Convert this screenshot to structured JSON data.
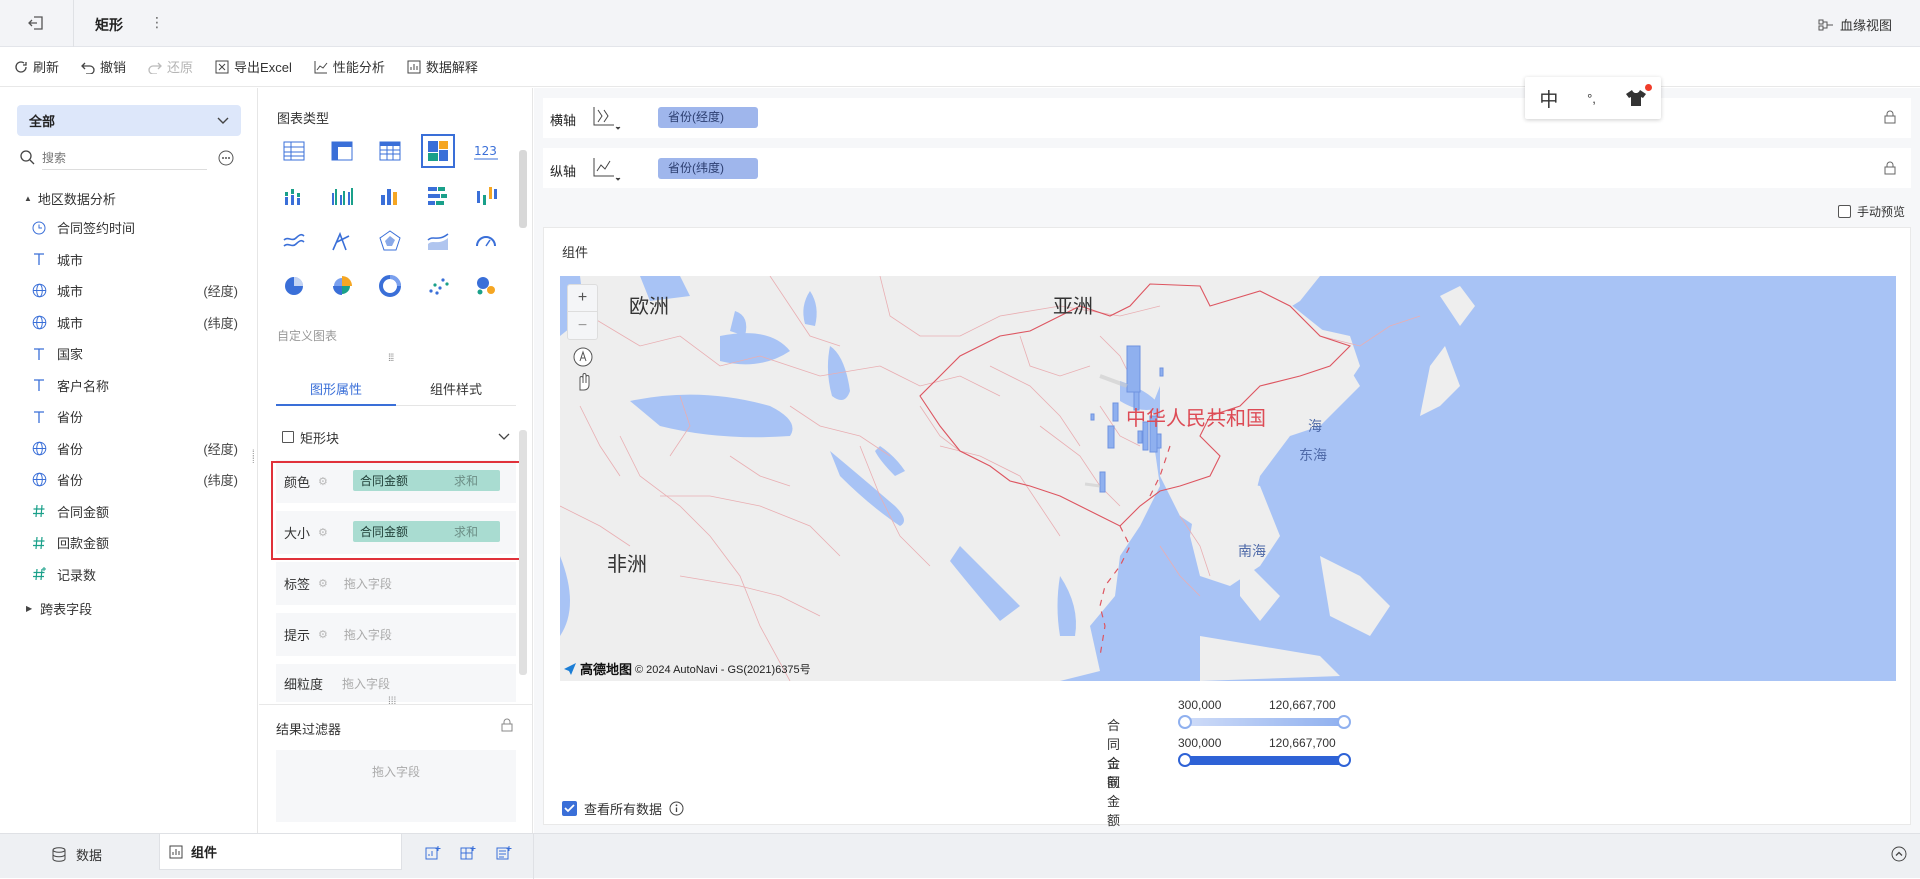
{
  "topbar": {
    "title": "矩形",
    "lineage_label": "血缘视图"
  },
  "toolbar": {
    "refresh": "刷新",
    "undo": "撤销",
    "redo": "还原",
    "export": "导出Excel",
    "perf": "性能分析",
    "explain": "数据解释"
  },
  "left": {
    "scope": "全部",
    "search_placeholder": "搜索",
    "group": "地区数据分析",
    "fields": [
      {
        "type": "time-icon",
        "name": "合同签约时间",
        "suffix": ""
      },
      {
        "type": "text-icon",
        "name": "城市",
        "suffix": ""
      },
      {
        "type": "globe-icon",
        "name": "城市",
        "suffix": "(经度)"
      },
      {
        "type": "globe-icon",
        "name": "城市",
        "suffix": "(纬度)"
      },
      {
        "type": "text-icon",
        "name": "国家",
        "suffix": ""
      },
      {
        "type": "text-icon",
        "name": "客户名称",
        "suffix": ""
      },
      {
        "type": "text-icon",
        "name": "省份",
        "suffix": ""
      },
      {
        "type": "globe-icon",
        "name": "省份",
        "suffix": "(经度)"
      },
      {
        "type": "globe-icon",
        "name": "省份",
        "suffix": "(纬度)"
      },
      {
        "type": "number-icon",
        "name": "合同金额",
        "suffix": ""
      },
      {
        "type": "number-icon",
        "name": "回款金额",
        "suffix": ""
      },
      {
        "type": "number-icon",
        "name": "记录数",
        "suffix": ""
      }
    ],
    "cross_table": "跨表字段"
  },
  "mid": {
    "chart_type_title": "图表类型",
    "custom_chart": "自定义图表",
    "tab_graph": "图形属性",
    "tab_style": "组件样式",
    "rect_block": "矩形块",
    "color_label": "颜色",
    "size_label": "大小",
    "label_label": "标签",
    "tip_label": "提示",
    "grain_label": "细粒度",
    "color_field": "合同金额",
    "color_agg": "求和",
    "size_field": "合同金额",
    "size_agg": "求和",
    "drop_placeholder": "拖入字段",
    "filter_title": "结果过滤器",
    "filter_placeholder": "拖入字段"
  },
  "right": {
    "x_axis_label": "横轴",
    "x_axis_field": "省份(经度)",
    "y_axis_label": "纵轴",
    "y_axis_field": "省份(纬度)",
    "manual_preview": "手动预览",
    "component_title": "组件",
    "see_all": "查看所有数据",
    "ime": {
      "char": "中",
      "punct": "°,"
    }
  },
  "map": {
    "labels": {
      "europe": "欧洲",
      "asia": "亚洲",
      "africa": "非洲",
      "china": "中华人民共和国",
      "east_sea_a": "海",
      "east_sea_b": "东海",
      "south_sea": "南海"
    },
    "logo": "高德地图",
    "copyright": "© 2024 AutoNavi - GS(2021)6375号",
    "colors": {
      "sea": "#a8c3f5",
      "land": "#eeeeee",
      "border": "#e07b83",
      "bar": "#8fb0ef"
    }
  },
  "legend": [
    {
      "label": "合同金额",
      "min": "300,000",
      "max": "120,667,700",
      "style": "light"
    },
    {
      "label": "合同金额",
      "min": "300,000",
      "max": "120,667,700",
      "style": "dark"
    }
  ],
  "bottom": {
    "data_tab": "数据",
    "component_tab": "组件"
  },
  "colors": {
    "accent": "#3a6fd8",
    "highlight": "#e0313a",
    "teal_chip": "#a9dcd1",
    "blue_chip": "#9fb6ec"
  }
}
